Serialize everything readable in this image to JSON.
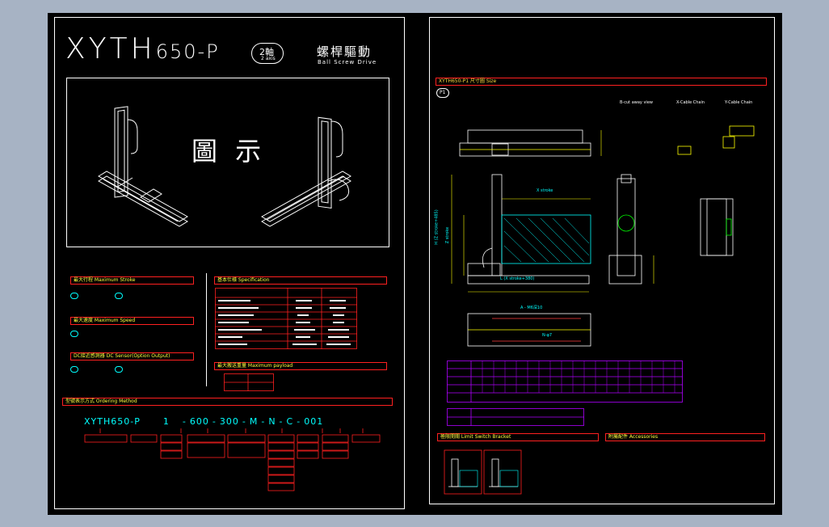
{
  "left_sheet": {
    "model": "XYTH",
    "model_suffix": "650-P",
    "axis_badge": "2軸",
    "axis_badge_en": "2 axis",
    "product_cn": "螺桿驅動",
    "product_en": "Ball Screw Drive",
    "figure_caption": "圖 示",
    "sections": {
      "stroke": "最大行程 Maximum Stroke",
      "speed": "最大速度 Maximum Speed",
      "sensor": "DC接近感測器 DC Sensor(Option Output)",
      "spec": "基本仕様 Specification",
      "payload": "最大搬送重量 Maximum payload",
      "ordering": "型號表示方式 Ordering Method"
    },
    "ordering_code": [
      "XYTH650",
      "P",
      "1",
      "600",
      "300",
      "M",
      "N",
      "C",
      "001"
    ],
    "ordering_seps": [
      "-",
      "-",
      "-",
      "-",
      "-",
      "-",
      "-",
      "-"
    ]
  },
  "right_sheet": {
    "size_header": "XYTH650-P1 尺寸圖 Size",
    "view_number": "P1",
    "view_labels": [
      "B-cut away view",
      "X-Cable Chain",
      "Y-Cable Chain"
    ],
    "dims": {
      "x_stroke": "X stroke",
      "l_dim": "L (X stroke+380)",
      "h_dim": "H (Z stroke+485)",
      "z_stroke": "Z stroke",
      "a_label": "A - M6深10",
      "n_label": "N-φ7"
    },
    "bottom_headers": {
      "limit": "極限開關 Limit Switch Bracket",
      "accessories": "附屬配件 Accessories"
    }
  },
  "colors": {
    "background": "#a7b3c4",
    "sheet": "#000000",
    "red": "#ff2020",
    "yellow": "#ffff00",
    "cyan": "#00ffff",
    "purple": "#b000ff"
  }
}
